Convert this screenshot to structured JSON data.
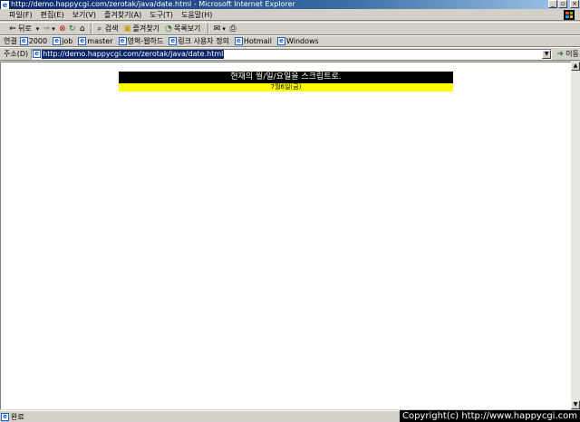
{
  "window": {
    "title": "http://demo.happycgi.com/zerotak/java/date.html - Microsoft Internet Explorer",
    "controls": [
      "_",
      "▫",
      "×"
    ]
  },
  "menubar": {
    "items": [
      "파일(F)",
      "편집(E)",
      "보기(V)",
      "즐겨찾기(A)",
      "도구(T)",
      "도움말(H)"
    ]
  },
  "toolbar": {
    "back_label": "뒤로",
    "search_label": "검색",
    "favorites_label": "즐겨찾기",
    "history_label": "목록보기"
  },
  "links": {
    "label": "연결",
    "items": [
      "2000",
      "job",
      "master",
      "영혁-웹하드",
      "링크 사용자 정의",
      "Hotmail",
      "Windows"
    ]
  },
  "address": {
    "label": "주소(D)",
    "url": "http://demo.happycgi.com/zerotak/java/date.html",
    "go_label": "이동"
  },
  "content": {
    "heading": "현재의 월/일/요일을 스크립트로.",
    "date_text": "7월6일(금)"
  },
  "status": {
    "text": "완료",
    "copyright": "Copyright(c) http://www.happycgi.com"
  },
  "colors": {
    "title_bar": "#0a246a",
    "banner_bg": "#000000",
    "date_bg": "#ffff00"
  }
}
